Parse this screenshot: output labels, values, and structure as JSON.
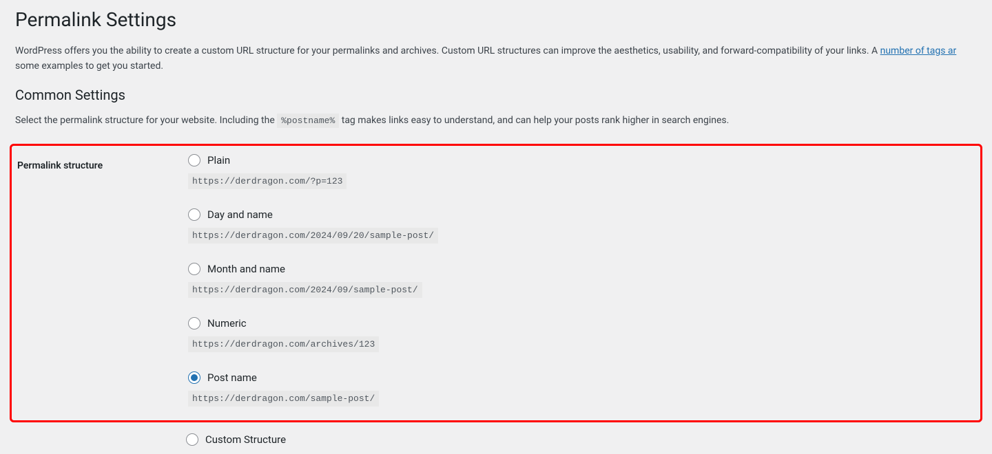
{
  "page": {
    "title": "Permalink Settings",
    "intro_before_link": "WordPress offers you the ability to create a custom URL structure for your permalinks and archives. Custom URL structures can improve the aesthetics, usability, and forward-compatibility of your links. A ",
    "intro_link_text": "number of tags ar",
    "intro_after_link": " some examples to get you started."
  },
  "common": {
    "heading": "Common Settings",
    "desc_before_tag": "Select the permalink structure for your website. Including the ",
    "tag": "%postname%",
    "desc_after_tag": " tag makes links easy to understand, and can help your posts rank higher in search engines."
  },
  "structure": {
    "label": "Permalink structure",
    "selected": "post_name",
    "options": [
      {
        "id": "plain",
        "label": "Plain",
        "example": "https://derdragon.com/?p=123"
      },
      {
        "id": "day_name",
        "label": "Day and name",
        "example": "https://derdragon.com/2024/09/20/sample-post/"
      },
      {
        "id": "month_name",
        "label": "Month and name",
        "example": "https://derdragon.com/2024/09/sample-post/"
      },
      {
        "id": "numeric",
        "label": "Numeric",
        "example": "https://derdragon.com/archives/123"
      },
      {
        "id": "post_name",
        "label": "Post name",
        "example": "https://derdragon.com/sample-post/"
      },
      {
        "id": "custom",
        "label": "Custom Structure",
        "example": ""
      }
    ]
  }
}
